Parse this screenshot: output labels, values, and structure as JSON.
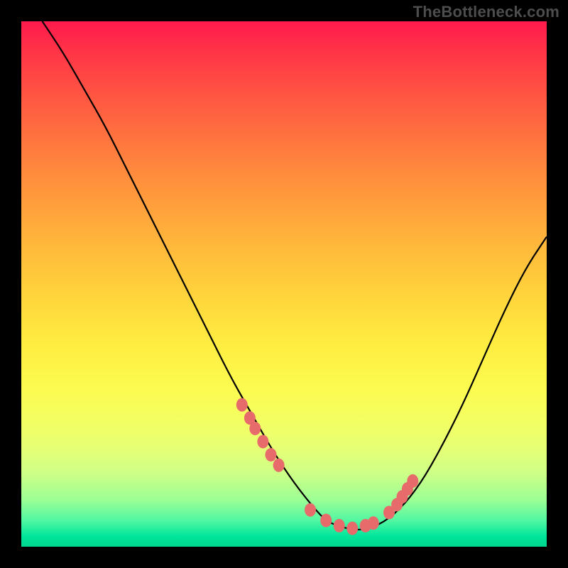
{
  "watermark": "TheBottleneck.com",
  "chart_data": {
    "type": "line",
    "title": "",
    "xlabel": "",
    "ylabel": "",
    "xlim": [
      0,
      100
    ],
    "ylim": [
      0,
      100
    ],
    "series": [
      {
        "name": "curve",
        "x": [
          4,
          8,
          12,
          16,
          20,
          24,
          28,
          32,
          36,
          40,
          44,
          48,
          52,
          56,
          58,
          60,
          64,
          68,
          72,
          76,
          80,
          84,
          88,
          92,
          96,
          100
        ],
        "y": [
          100,
          94,
          87,
          80,
          72,
          64,
          56,
          48,
          40,
          32,
          25,
          18,
          12,
          7,
          5,
          4,
          3,
          4,
          7,
          12,
          19,
          27,
          36,
          45,
          53,
          59
        ]
      }
    ],
    "highlight_points": {
      "name": "dots",
      "x": [
        42,
        43.5,
        44.5,
        46,
        47.5,
        49,
        55,
        58,
        60.5,
        63,
        65.5,
        67,
        70,
        71.5,
        72.5,
        73.5,
        74.5
      ],
      "y": [
        27,
        24.5,
        22.5,
        20,
        17.5,
        15.5,
        7,
        5,
        4,
        3.5,
        4,
        4.5,
        6.5,
        8,
        9.5,
        11,
        12.5
      ]
    }
  }
}
